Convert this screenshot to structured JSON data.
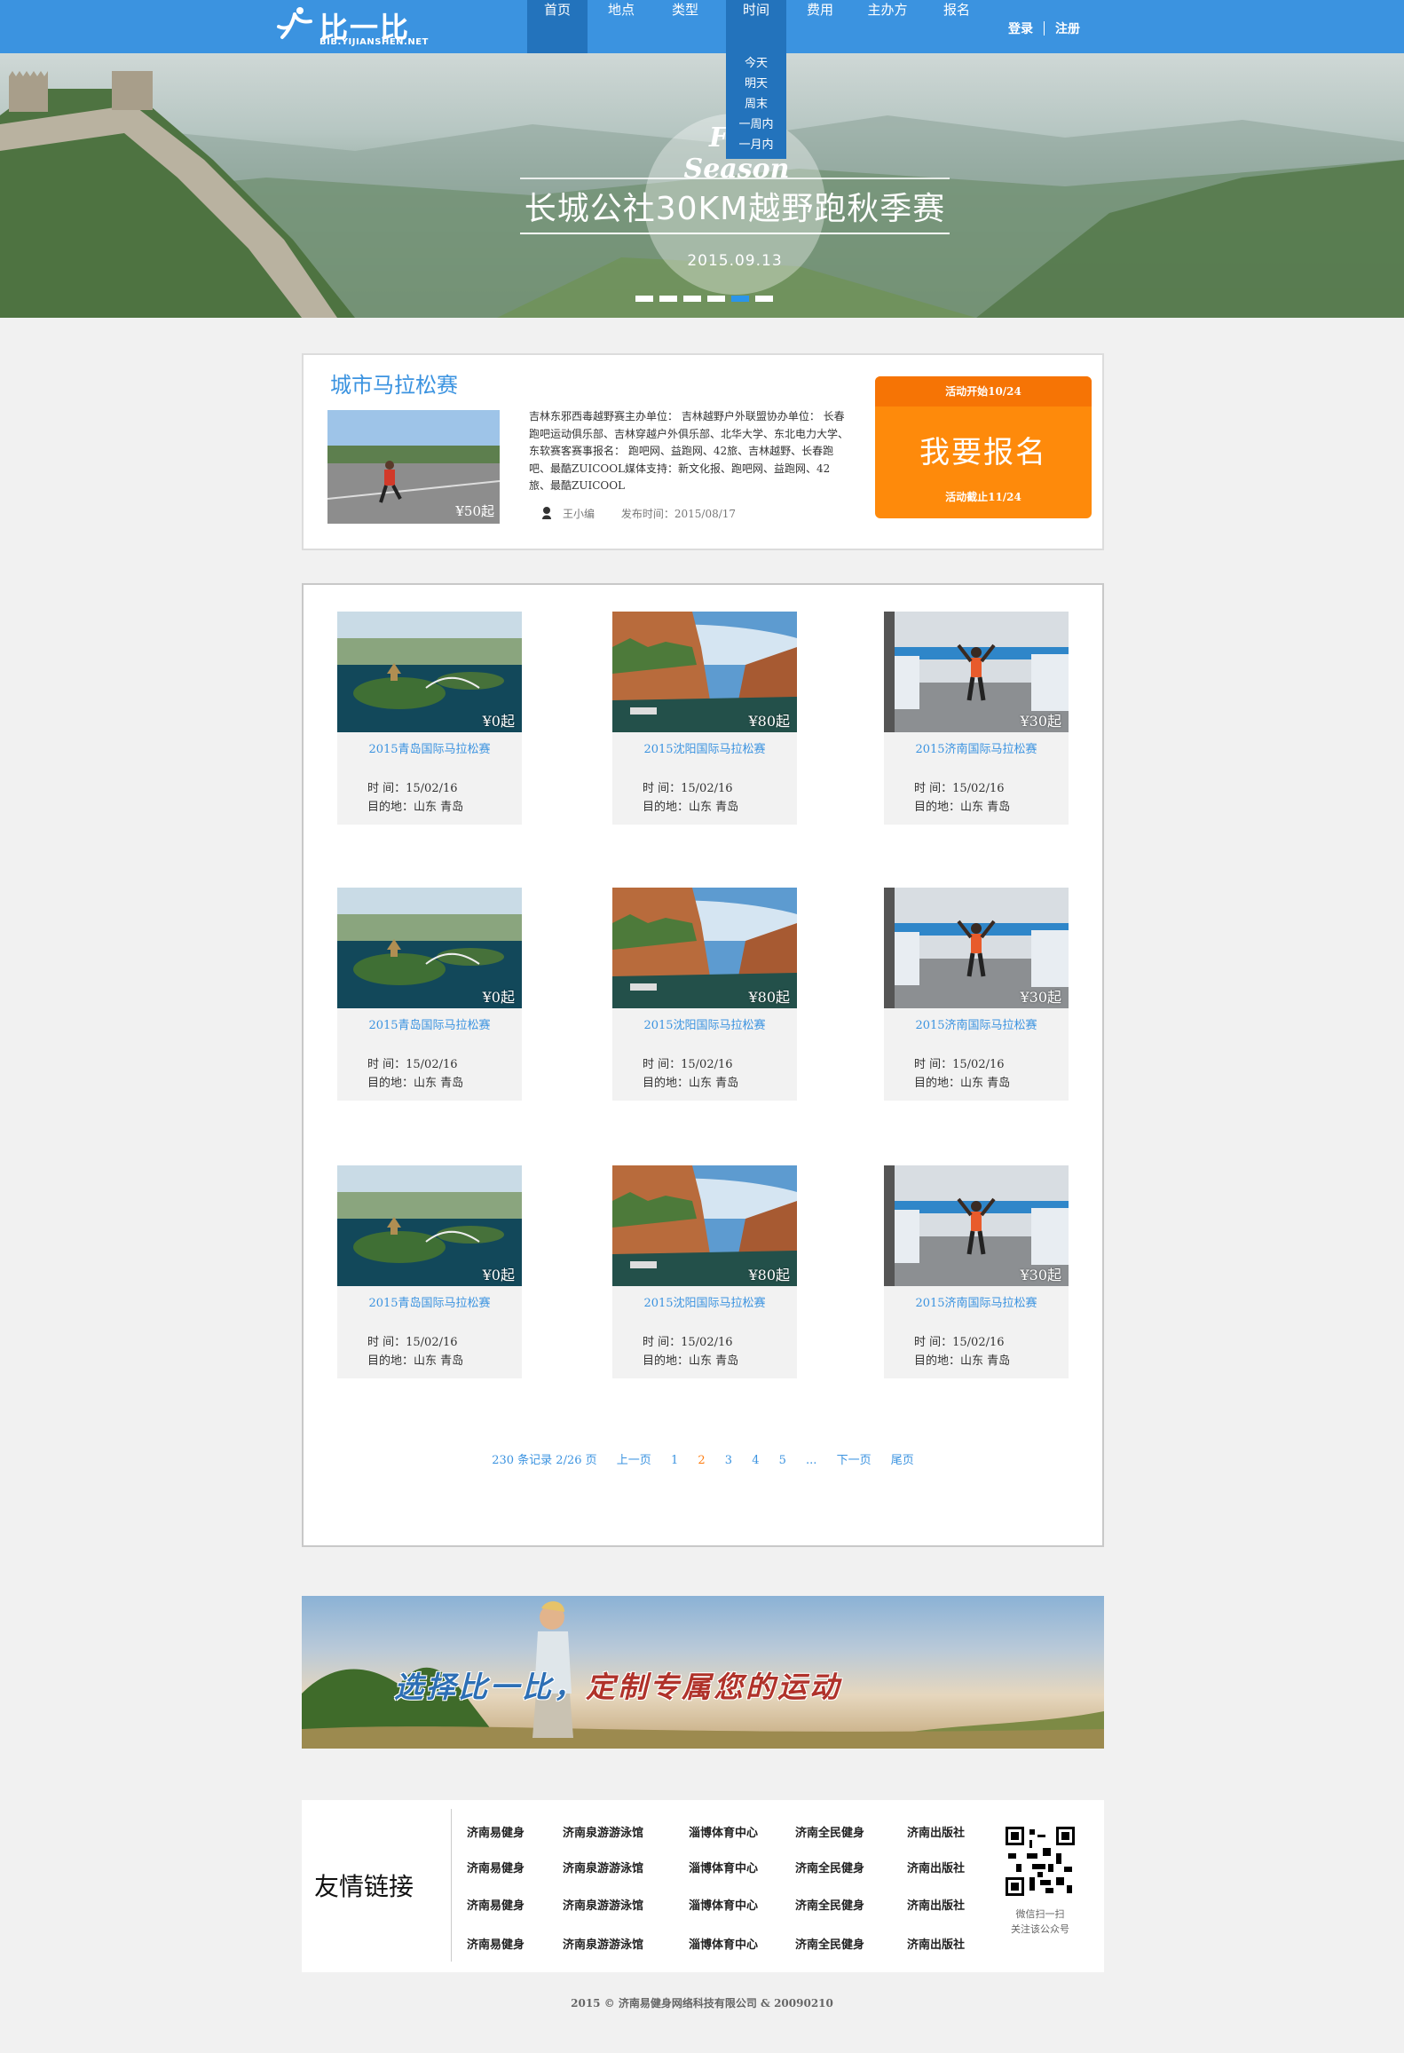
{
  "header": {
    "logo_text": "比一比",
    "logo_sub": "BIB.YIJIANSHEN.NET",
    "nav": [
      "首页",
      "地点",
      "类型",
      "时间",
      "费用",
      "主办方",
      "报名"
    ],
    "login": "登录",
    "register": "注册",
    "time_dropdown": [
      "今天",
      "明天",
      "周末",
      "一周内",
      "一月内"
    ]
  },
  "hero": {
    "script_text": "Fall Season",
    "title": "长城公社30KM越野跑秋季赛",
    "date": "2015.09.13",
    "slide_count": 6,
    "active_slide": 5
  },
  "featured": {
    "title": "城市马拉松赛",
    "price": "¥50起",
    "description": "吉林东邪西毒越野赛主办单位： 吉林越野户外联盟协办单位： 长春跑吧运动俱乐部、吉林穿越户外俱乐部、北华大学、东北电力大学、东软赛客赛事报名： 跑吧网、益跑网、42旅、吉林越野、长春跑吧、最酷ZUICOOL媒体支持：新文化报、跑吧网、益跑网、42旅、最酷ZUICOOL",
    "author": "王小编",
    "publish_label": "发布时间：",
    "publish_date": "2015/08/17",
    "signup_start": "活动开始10/24",
    "signup_button": "我要报名",
    "signup_end": "活动截止11/24"
  },
  "cards": [
    {
      "title": "2015青岛国际马拉松赛",
      "price": "¥0起",
      "time": "时  间：15/02/16",
      "dest": "目的地：山东 青岛",
      "img": "lake"
    },
    {
      "title": "2015沈阳国际马拉松赛",
      "price": "¥80起",
      "time": "时  间：15/02/16",
      "dest": "目的地：山东 青岛",
      "img": "cliff"
    },
    {
      "title": "2015济南国际马拉松赛",
      "price": "¥30起",
      "time": "时  间：15/02/16",
      "dest": "目的地：山东 青岛",
      "img": "runner"
    },
    {
      "title": "2015青岛国际马拉松赛",
      "price": "¥0起",
      "time": "时  间：15/02/16",
      "dest": "目的地：山东 青岛",
      "img": "lake"
    },
    {
      "title": "2015沈阳国际马拉松赛",
      "price": "¥80起",
      "time": "时  间：15/02/16",
      "dest": "目的地：山东 青岛",
      "img": "cliff"
    },
    {
      "title": "2015济南国际马拉松赛",
      "price": "¥30起",
      "time": "时  间：15/02/16",
      "dest": "目的地：山东 青岛",
      "img": "runner"
    },
    {
      "title": "2015青岛国际马拉松赛",
      "price": "¥0起",
      "time": "时  间：15/02/16",
      "dest": "目的地：山东 青岛",
      "img": "lake"
    },
    {
      "title": "2015沈阳国际马拉松赛",
      "price": "¥80起",
      "time": "时  间：15/02/16",
      "dest": "目的地：山东 青岛",
      "img": "cliff"
    },
    {
      "title": "2015济南国际马拉松赛",
      "price": "¥30起",
      "time": "时  间：15/02/16",
      "dest": "目的地：山东 青岛",
      "img": "runner"
    }
  ],
  "pager": {
    "summary": "230 条记录 2/26 页",
    "prev": "上一页",
    "pages": [
      "1",
      "2",
      "3",
      "4",
      "5"
    ],
    "current": "2",
    "ellipsis": "...",
    "next": "下一页",
    "last": "尾页"
  },
  "banner": {
    "text_blue": "选择比一比，",
    "text_red": "定制专属您的运动"
  },
  "links": {
    "title": "友情链接",
    "rows": [
      [
        "济南易健身",
        "济南泉游游泳馆",
        "淄博体育中心",
        "济南全民健身",
        "济南出版社"
      ],
      [
        "济南易健身",
        "济南泉游游泳馆",
        "淄博体育中心",
        "济南全民健身",
        "济南出版社"
      ],
      [
        "济南易健身",
        "济南泉游游泳馆",
        "淄博体育中心",
        "济南全民健身",
        "济南出版社"
      ],
      [
        "济南易健身",
        "济南泉游游泳馆",
        "淄博体育中心",
        "济南全民健身",
        "济南出版社"
      ]
    ],
    "qr_line1": "微信扫一扫",
    "qr_line2": "关注该公众号"
  },
  "footer": "2015 © 济南易健身网络科技有限公司 & 20090210",
  "colors": {
    "header_blue": "#3b93e0",
    "nav_active": "#2373bc",
    "signup_orange": "#fe8a0b",
    "link_blue": "#3b93e0",
    "pager_current": "#fe7e12"
  }
}
